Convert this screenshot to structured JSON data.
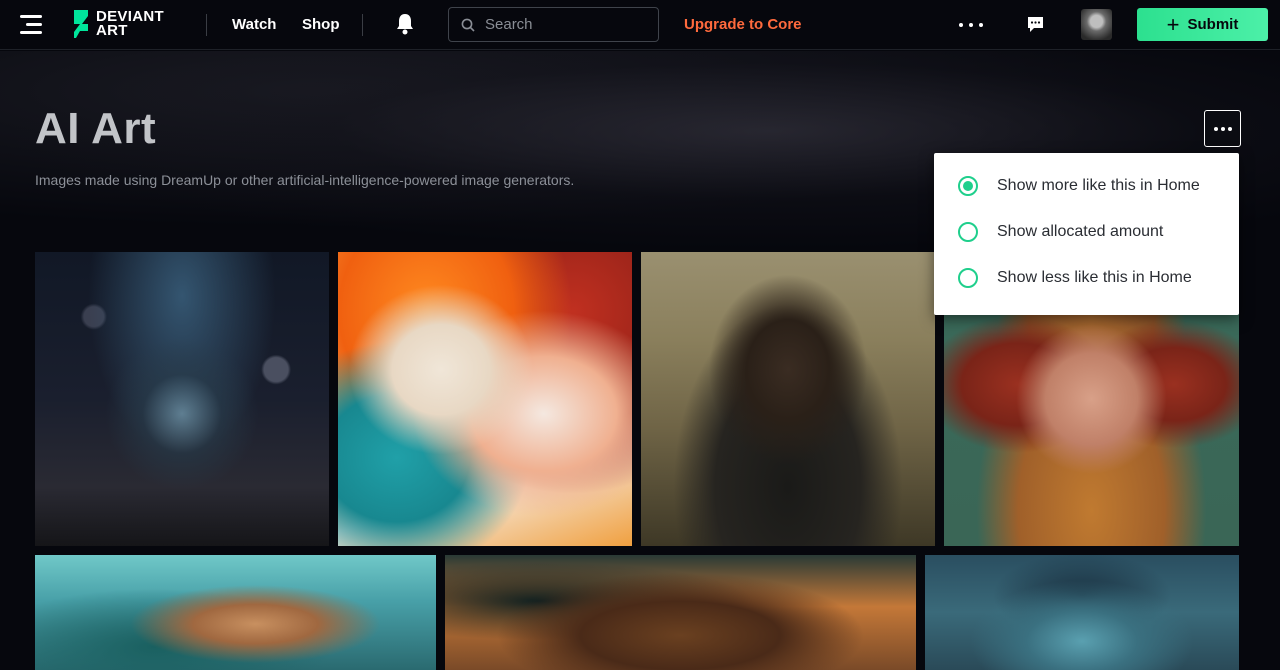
{
  "header": {
    "logo_line1": "DEVIANT",
    "logo_line2": "ART",
    "nav": [
      "Watch",
      "Shop"
    ],
    "search_placeholder": "Search",
    "upgrade_label": "Upgrade to Core",
    "submit_label": "Submit",
    "accent_color": "#2ce08f",
    "upgrade_color": "#ff6a3d"
  },
  "page": {
    "title": "AI Art",
    "description": "Images made using DreamUp or other artificial-intelligence-powered image generators."
  },
  "menu": {
    "options": [
      {
        "label": "Show more like this in Home",
        "selected": true
      },
      {
        "label": "Show allocated amount",
        "selected": false
      },
      {
        "label": "Show less like this in Home",
        "selected": false
      }
    ]
  },
  "icons": [
    "menu-icon",
    "deviantart-logo-icon",
    "bell-icon",
    "search-icon",
    "more-icon",
    "chat-icon",
    "avatar",
    "plus-icon"
  ]
}
